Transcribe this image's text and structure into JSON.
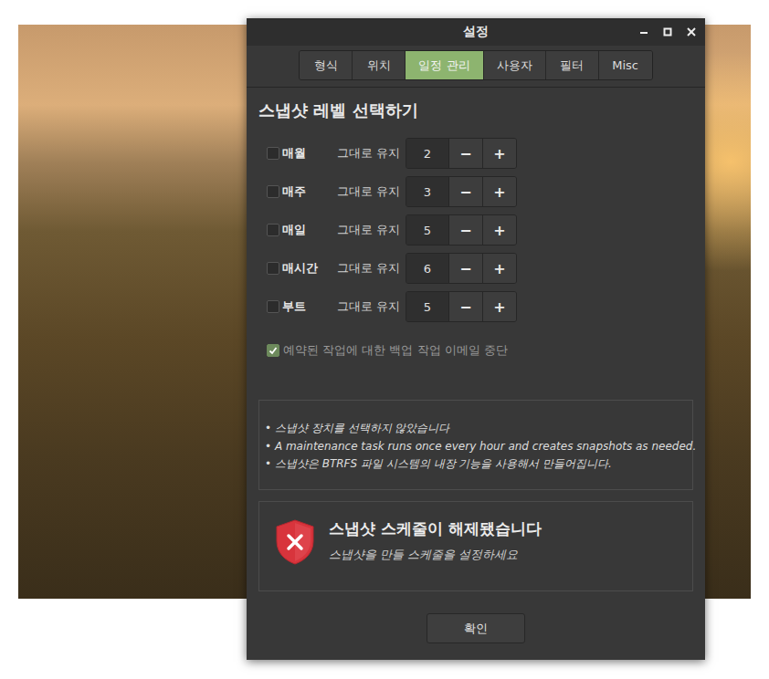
{
  "window": {
    "title": "설정"
  },
  "tabs": [
    {
      "label": "형식",
      "selected": false
    },
    {
      "label": "위치",
      "selected": false
    },
    {
      "label": "일정 관리",
      "selected": true
    },
    {
      "label": "사용자",
      "selected": false
    },
    {
      "label": "필터",
      "selected": false
    },
    {
      "label": "Misc",
      "selected": false
    }
  ],
  "heading": "스냅샷 레벨 선택하기",
  "levels": [
    {
      "label": "매월",
      "checked": false,
      "keep_label": "그대로 유지",
      "value": "2",
      "minus": "−",
      "plus": "+"
    },
    {
      "label": "매주",
      "checked": false,
      "keep_label": "그대로 유지",
      "value": "3",
      "minus": "−",
      "plus": "+"
    },
    {
      "label": "매일",
      "checked": false,
      "keep_label": "그대로 유지",
      "value": "5",
      "minus": "−",
      "plus": "+"
    },
    {
      "label": "매시간",
      "checked": false,
      "keep_label": "그대로 유지",
      "value": "6",
      "minus": "−",
      "plus": "+"
    },
    {
      "label": "부트",
      "checked": false,
      "keep_label": "그대로 유지",
      "value": "5",
      "minus": "−",
      "plus": "+"
    }
  ],
  "email_option": {
    "label": "예약된 작업에 대한 백업 작업 이메일 중단",
    "checked": true,
    "disabled": true
  },
  "info": [
    "• 스냅샷 장치를 선택하지 않았습니다",
    "• A maintenance task runs once every hour and creates snapshots as needed.",
    "• 스냅샷은 BTRFS 파일 시스템의 내장 기능을 사용해서 만들어집니다."
  ],
  "status": {
    "title": "스냅샷 스케줄이 해제됐습니다",
    "subtitle": "스냅샷을 만들 스케줄을 설정하세요"
  },
  "buttons": [
    "확인"
  ]
}
